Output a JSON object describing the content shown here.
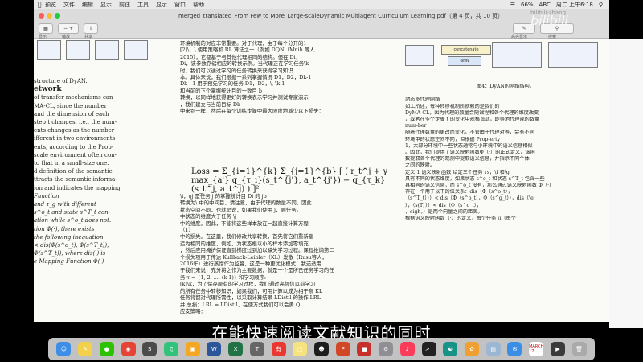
{
  "menubar": {
    "items": [
      "预览",
      "文件",
      "编辑",
      "显示",
      "前往",
      "工具",
      "显示",
      "窗口",
      "帮助"
    ],
    "battery": "66%",
    "clock": "周二 上午6:18",
    "abc": "ABC"
  },
  "window": {
    "title": "merged_translated_From Few to More_Large-scaleDynamic Multiagent Curriculum Learning.pdf（第 4 页，共 10 页）",
    "toolbar": {
      "display_label": "显示",
      "zoom_label": "缩放",
      "share_label": "共享",
      "highlight_label": "高亮显示",
      "search_label": "搜索"
    }
  },
  "left_column": {
    "lines": [
      "structure of DyAN.",
      "",
      "etwork",
      "",
      "of transfer mechanisms can",
      "MA-CL, since the number",
      "and the dimension of each",
      "step t changes, i.e., the num-",
      "ents changes as the number",
      "",
      "",
      "ifferent in two environments",
      "ents, according to the Prop-",
      "scale environment often con-",
      "to that in a small-size one.",
      "d definition of the semantic",
      "ttracts the semantic informa-",
      "ion and indicates the mapping",
      "",
      "Function",
      "and τ_g with different",
      "s^o_t and state s^T_t con-",
      "ation while s^o_t does not.",
      "tion Φ(·), there exists",
      "the following inequation",
      "< dis(Φ(s^o_t), Φ(s^T_t)),",
      "Φ(s^T_t)), where dis(·) is",
      "",
      "e Mapping Function Φ(·)"
    ]
  },
  "middle_column": {
    "top_lines": [
      "环境机制的对应非常重要。对于代理，由于每个分开的1",
      "[2]\\，\\ 使用策略和 RL 算法之一（例如 DQN（Mnih 等人",
      "2015），它都基于与其他代理相同的结构。但在 Di，",
      "Di，该参数存储相应的转换示例。当代理正在学习任务\\k",
      "时，我们可以通过学习的任务转换来获得学习知识",
      "本。具体来说，我们根据一系列掌握情况 D1，D2，Dk-1",
      "Dk - 1 用于预先学习的任务 D1，D2，\\, \\k-1",
      "和当前的下个掌握统计目的一致目 b",
      "转换，以同样地获得更好的转换表示学习并测试专家演示",
      "，我们建立与当前目标 Dk",
      "中来到一样，然后在每个训练步骤中最大限度地减少以下损失："
    ],
    "formula": "Loss = Σ_{i=1}^{k} Σ_{j=1}^{b} [ ( r_t^j + γ max_{a'} q_{τ_i}(s_t^{j'}, a_t^{j'}) − q_{τ_k}(s_t^j, a_t^j) ) ]²",
    "bottom_lines": [
      "\\i，ηj 是任务 j 的掌握统计目 Di 的 jb",
      "转换为\\ 中的中间目，请注意，由于代理的数量不同，因此",
      "状态空间不同，也就是说，如果我们使用 j，则任务\\",
      "中状态的维度大于任务 \\j",
      "中的维度。因此，不能将这些样本放在一起直接计算方程",
      "（1）",
      "中的损失。在这里，我们修改共享转换，首先将它们重新塑",
      "造为相同的维度，例如，为状态根以小的样本添加零填充",
      "，然后应用掩护保证直到梯度过到加以缺失学习过程。课程推熵第二",
      "个损失项用于传达 Kullback-Leibler（KL）发散（Rusu等人，",
      "2016年）进行蒸馏作为监督，这是一种更优化模式，我还适用",
      "于我们来说，充分将之作为主要数据，就是一个是所已任务学习的任",
      "务 τ = {1, 2, ..., (k-1)} 和学习顺序:",
      "[k]\\k，为了保存原有的学习过程，我们通过高频信以前学习",
      "的所有任务中转移知识，如果我们，可用计算以成为相于条 KL",
      "任务将都对代理所需性，以采取计算结果 LDistil 的操作 LRL",
      "并 总损：LRL = LDistil，在使方式我们可以会勇 Q",
      "应支策略："
    ]
  },
  "right_column": {
    "diagram": {
      "concatenate_label": "concatenate",
      "gnn_label": "GNN",
      "caption": "图4：DyAN的网络结构。"
    },
    "lines": [
      "动态多代理网络",
      "",
      "如上所述，每种转移机制所依赖的是我们的",
      "DyMA-CL，因为代理的数量会随课程和各个代理的维度改变",
      "，或者在多个步骤 t 的变化中规格 mit，即等地代理规的数量",
      "num-ber",
      "随着代理数量的更改而变化，不管由于代理对等，会有不同",
      "环境中的状态空间不同，但根据 Prop-erty",
      "1，大部分环境中一些状态通常与小环境中的语义信息相似",
      "。因此，我们提供了语义映射函数Φ（·）的正式定义，该函",
      "数提取各个代理的观测中提取语义信息，并指示不同个体",
      "之间的映射。",
      "",
      "",
      "",
      "",
      "",
      "定义 1 语义映射函数 给定三个任务 τs，\\f 和\\g",
      "具有不同的状态维度，如果状态 s^o_t 和状态 s^T_t 包含一些",
      "具相同的语义信息，而 s^o_t 没有，那么通过语义映射函数 Φ（·）",
      "存在一个用于以下的位关系：dis（Φ（s^o_t），",
      "（s^T_t）））< dis（Φ（s^o_t），Φ（s^g_t）），dis（\\e",
      "），（s(T）））< dis（Φ（s^o_t），",
      "，sigh，）是两个向量之间的距离。",
      "",
      "",
      "根据语义映射函数（·）的定义，每个任务 \\i（每个"
    ]
  },
  "subtitle": "在能快速阅读文献知识的同时",
  "watermark": {
    "logo": "bilibili",
    "user": "bilibili·zhang"
  },
  "dock": {
    "items": [
      "finder-icon",
      "notes-icon",
      "wechat-icon",
      "chrome-icon",
      "sublime-icon",
      "qq-music-icon",
      "notebook-icon",
      "word-icon",
      "excel-icon",
      "tex-icon",
      "youdao-icon",
      "stickies-icon",
      "qq-icon",
      "powerpoint-icon",
      "pdf-icon",
      "settings-icon",
      "music-icon",
      "terminal-icon",
      "gitkraken-icon",
      "photos-icon",
      "preview-icon",
      "mail-icon",
      "calendar-icon",
      "video-icon",
      "trash-icon"
    ],
    "calendar_text": "MARCH 17"
  }
}
